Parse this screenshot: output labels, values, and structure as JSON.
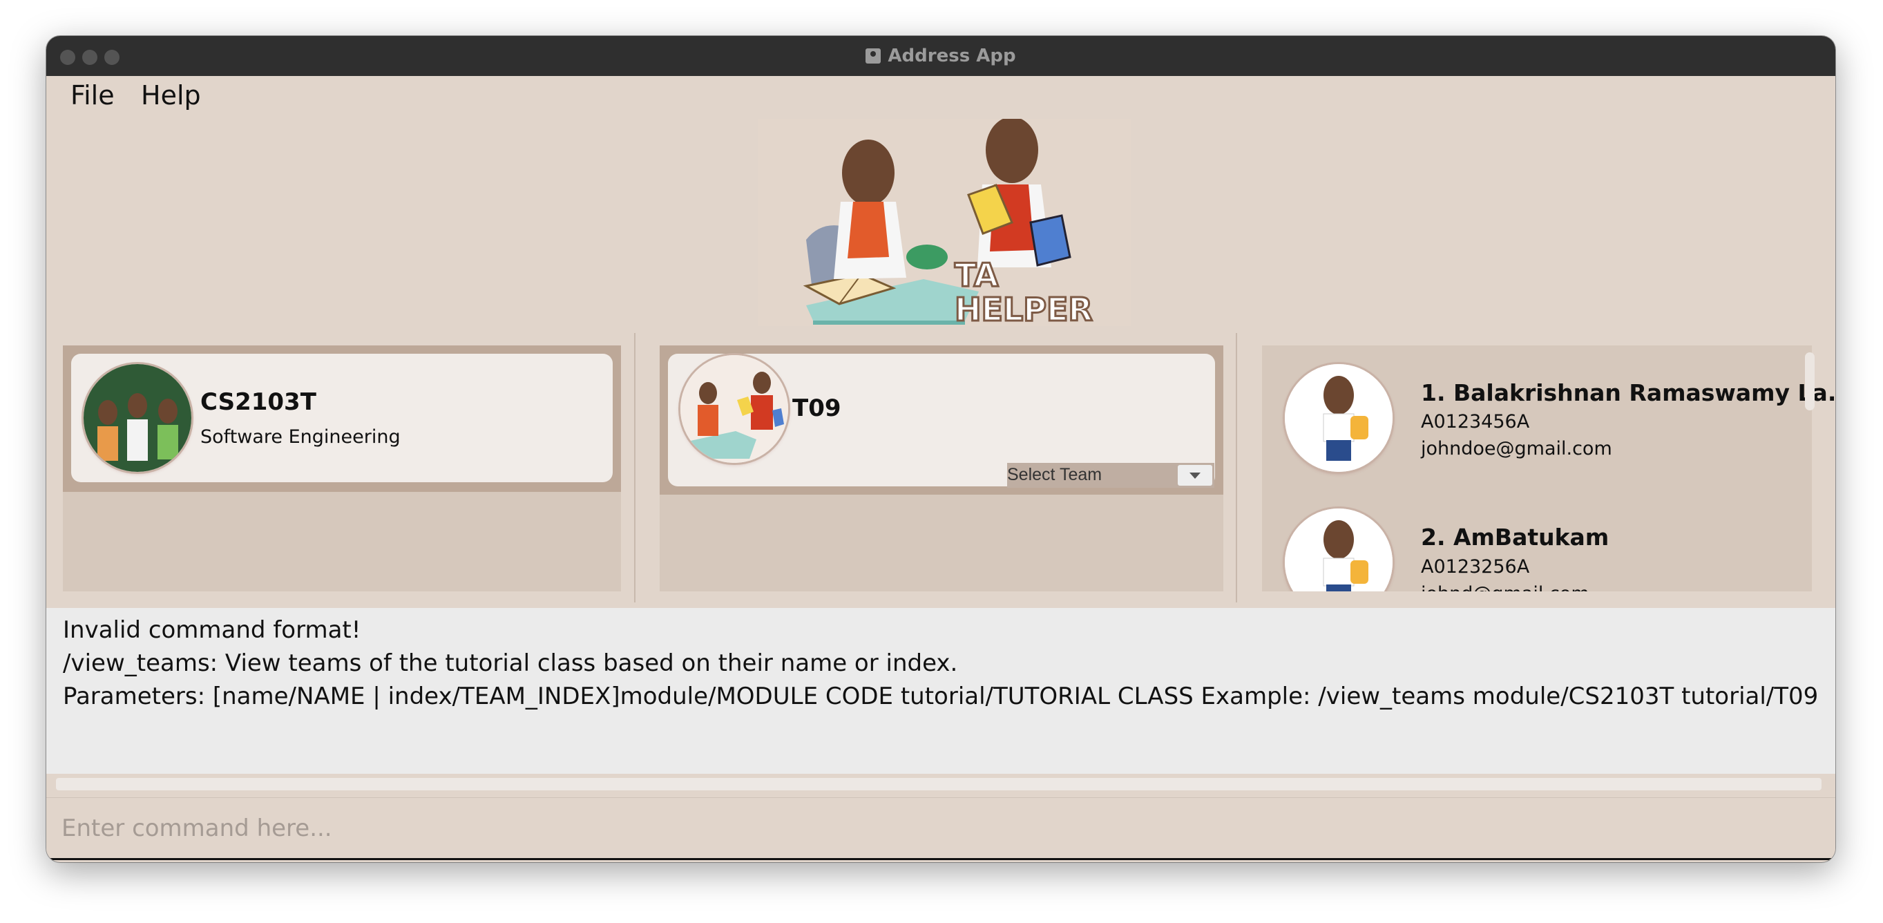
{
  "window": {
    "title": "Address App"
  },
  "menu": {
    "file": "File",
    "help": "Help"
  },
  "logo": {
    "line1": "TA",
    "line2": "HELPER"
  },
  "module": {
    "code": "CS2103T",
    "name": "Software Engineering"
  },
  "tutorial": {
    "name": "T09",
    "select_team": "Select Team"
  },
  "students": [
    {
      "index": "1.",
      "name": "Balakrishnan Ramaswamy La...",
      "id": "A0123456A",
      "email": "johndoe@gmail.com"
    },
    {
      "index": "2.",
      "name": "AmBatukam",
      "id": "A0123256A",
      "email": "johnd@gmail.com"
    }
  ],
  "result": {
    "line1": "Invalid command format!",
    "line2": "/view_teams: View teams of the tutorial class based on their name or index.",
    "line3": "Parameters: [name/NAME | index/TEAM_INDEX]module/MODULE CODE tutorial/TUTORIAL CLASS Example: /view_teams module/CS2103T tutorial/T09"
  },
  "command": {
    "placeholder": "Enter command here..."
  },
  "colors": {
    "background": "#e1d5cb",
    "panel": "#d6c8bc",
    "card": "#f1ece8",
    "titlebar": "#2f2f2f"
  }
}
